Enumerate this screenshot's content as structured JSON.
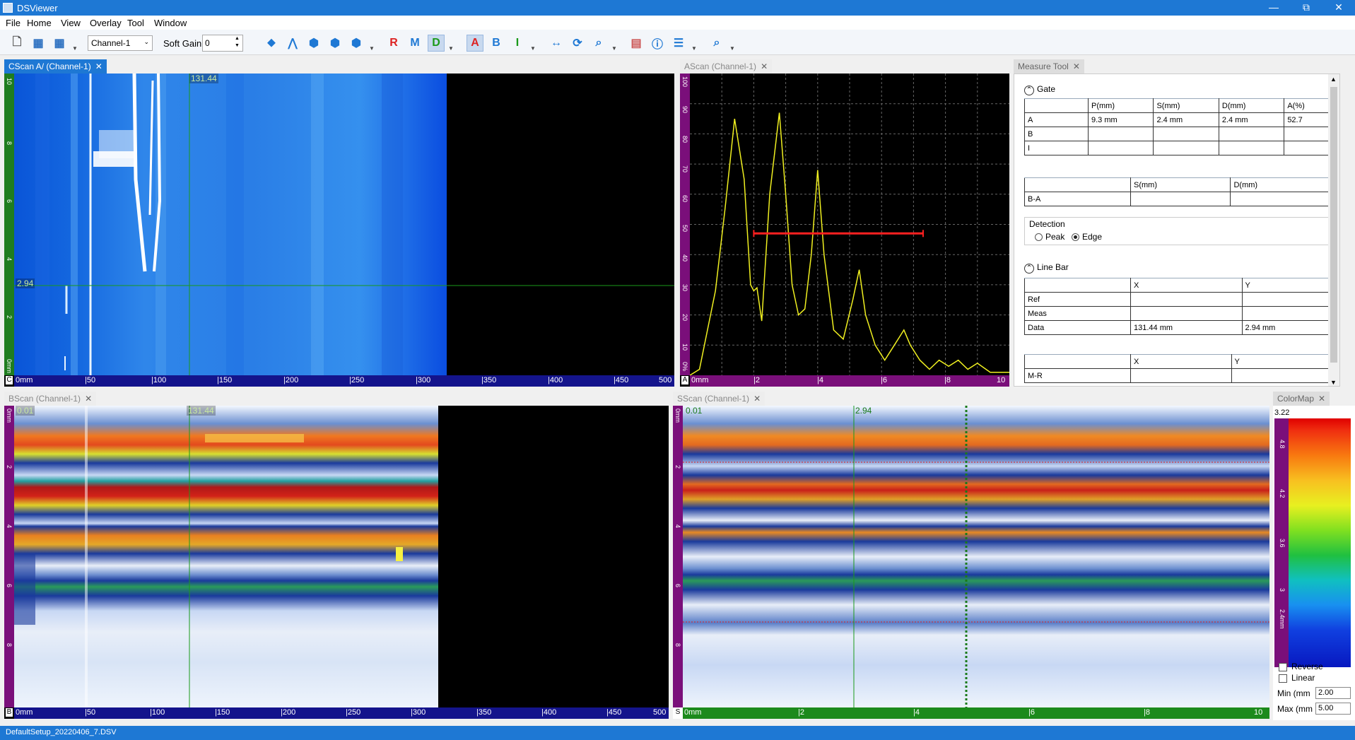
{
  "window": {
    "title": "DSViewer",
    "minimize": "—",
    "restore": "⧉",
    "close": "✕"
  },
  "menu": [
    "File",
    "Home",
    "View",
    "Overlay",
    "Tool",
    "Window"
  ],
  "toolbar": {
    "channel": "Channel-1",
    "soft_gain_label": "Soft Gain",
    "soft_gain_value": "0",
    "icons": [
      "new-file-icon",
      "add-grid-icon",
      "grid-icon",
      "pointer-icon",
      "peak-icon",
      "cube-front-icon",
      "cube-side-icon",
      "cube-top-icon",
      "ref-cursor-icon",
      "meas-cursor-icon",
      "data-cursor-icon",
      "gate-a-icon",
      "gate-b-icon",
      "gate-i-icon",
      "distance-icon",
      "refresh-icon",
      "zoom-icon",
      "colormap-icon",
      "info-icon",
      "list-icon",
      "search-zoom-icon"
    ]
  },
  "cscan": {
    "tab": "CScan A/ (Channel-1)",
    "cursor_x_label": "131.44",
    "cursor_y_label": "2.94",
    "corner": "C",
    "x_ticks": [
      "0mm",
      "|50",
      "|100",
      "|150",
      "|200",
      "|250",
      "|300",
      "|350",
      "|400",
      "|450",
      "500"
    ],
    "y_ticks": [
      "0mm",
      "2",
      "4",
      "6",
      "8",
      "10"
    ]
  },
  "ascan": {
    "tab": "AScan (Channel-1)",
    "corner": "A",
    "x_ticks": [
      "0mm",
      "|2",
      "|4",
      "|6",
      "|8",
      "10"
    ],
    "y_ticks": [
      "0%",
      "10",
      "20",
      "30",
      "40",
      "50",
      "60",
      "70",
      "80",
      "90",
      "100"
    ],
    "peaks_percent": [
      [
        0,
        0
      ],
      [
        0.3,
        2
      ],
      [
        0.8,
        28
      ],
      [
        1.1,
        55
      ],
      [
        1.4,
        85
      ],
      [
        1.7,
        65
      ],
      [
        1.9,
        30
      ],
      [
        2.0,
        28
      ],
      [
        2.1,
        29
      ],
      [
        2.25,
        18
      ],
      [
        2.5,
        60
      ],
      [
        2.8,
        87
      ],
      [
        3.0,
        60
      ],
      [
        3.2,
        30
      ],
      [
        3.4,
        20
      ],
      [
        3.6,
        22
      ],
      [
        3.8,
        40
      ],
      [
        4.0,
        68
      ],
      [
        4.2,
        40
      ],
      [
        4.5,
        15
      ],
      [
        4.8,
        12
      ],
      [
        5.1,
        25
      ],
      [
        5.3,
        35
      ],
      [
        5.5,
        20
      ],
      [
        5.8,
        10
      ],
      [
        6.1,
        5
      ],
      [
        6.4,
        10
      ],
      [
        6.7,
        15
      ],
      [
        6.9,
        10
      ],
      [
        7.2,
        5
      ],
      [
        7.5,
        2
      ],
      [
        7.8,
        5
      ],
      [
        8.1,
        3
      ],
      [
        8.4,
        5
      ],
      [
        8.7,
        2
      ],
      [
        9.0,
        4
      ],
      [
        9.4,
        1
      ],
      [
        10,
        1
      ]
    ],
    "gate": {
      "start": 2.0,
      "end": 7.3,
      "level": 47
    }
  },
  "measure": {
    "tab": "Measure Tool",
    "gate_title": "Gate",
    "gate_headers": [
      "",
      "P(mm)",
      "S(mm)",
      "D(mm)",
      "A(%)"
    ],
    "gate_rows": [
      [
        "A",
        "9.3 mm",
        "2.4 mm",
        "2.4 mm",
        "52.7"
      ],
      [
        "B",
        "",
        "",
        "",
        ""
      ],
      [
        "I",
        "",
        "",
        "",
        ""
      ]
    ],
    "ba_headers": [
      "",
      "S(mm)",
      "D(mm)"
    ],
    "ba_row": [
      "B-A",
      "",
      ""
    ],
    "detection_label": "Detection",
    "peak_label": "Peak",
    "edge_label": "Edge",
    "line_bar_title": "Line Bar",
    "line_headers": [
      "",
      "X",
      "Y"
    ],
    "line_rows": [
      [
        "Ref",
        "",
        ""
      ],
      [
        "Meas",
        "",
        ""
      ],
      [
        "Data",
        "131.44 mm",
        "2.94 mm"
      ]
    ],
    "mr_headers": [
      "",
      "X",
      "Y"
    ],
    "mr_row": [
      "M-R",
      "",
      ""
    ]
  },
  "bscan": {
    "tab": "BScan (Channel-1)",
    "left_label": "0.01",
    "cursor_label": "131.44",
    "corner": "B",
    "x_ticks": [
      "0mm",
      "|50",
      "|100",
      "|150",
      "|200",
      "|250",
      "|300",
      "|350",
      "|400",
      "|450",
      "500"
    ],
    "y_ticks": [
      "0mm",
      "2",
      "4",
      "6",
      "8"
    ]
  },
  "sscan": {
    "tab": "SScan (Channel-1)",
    "left_label": "0.01",
    "cursor_label": "2.94",
    "corner": "S",
    "x_ticks": [
      "0mm",
      "|2",
      "|4",
      "|6",
      "|8",
      "10"
    ],
    "y_ticks": [
      "0mm",
      "2",
      "4",
      "6",
      "8"
    ]
  },
  "colormap": {
    "tab": "ColorMap",
    "max_value": "3.22",
    "scale_labels": [
      "4.8",
      "4.2",
      "3.6",
      "3",
      "2.4mm"
    ],
    "reverse_label": "Reverse",
    "linear_label": "Linear",
    "min_label": "Min (mm",
    "min_value": "2.00",
    "max_label": "Max (mm",
    "max_input": "5.00"
  },
  "status": "DefaultSetup_20220406_7.DSV"
}
